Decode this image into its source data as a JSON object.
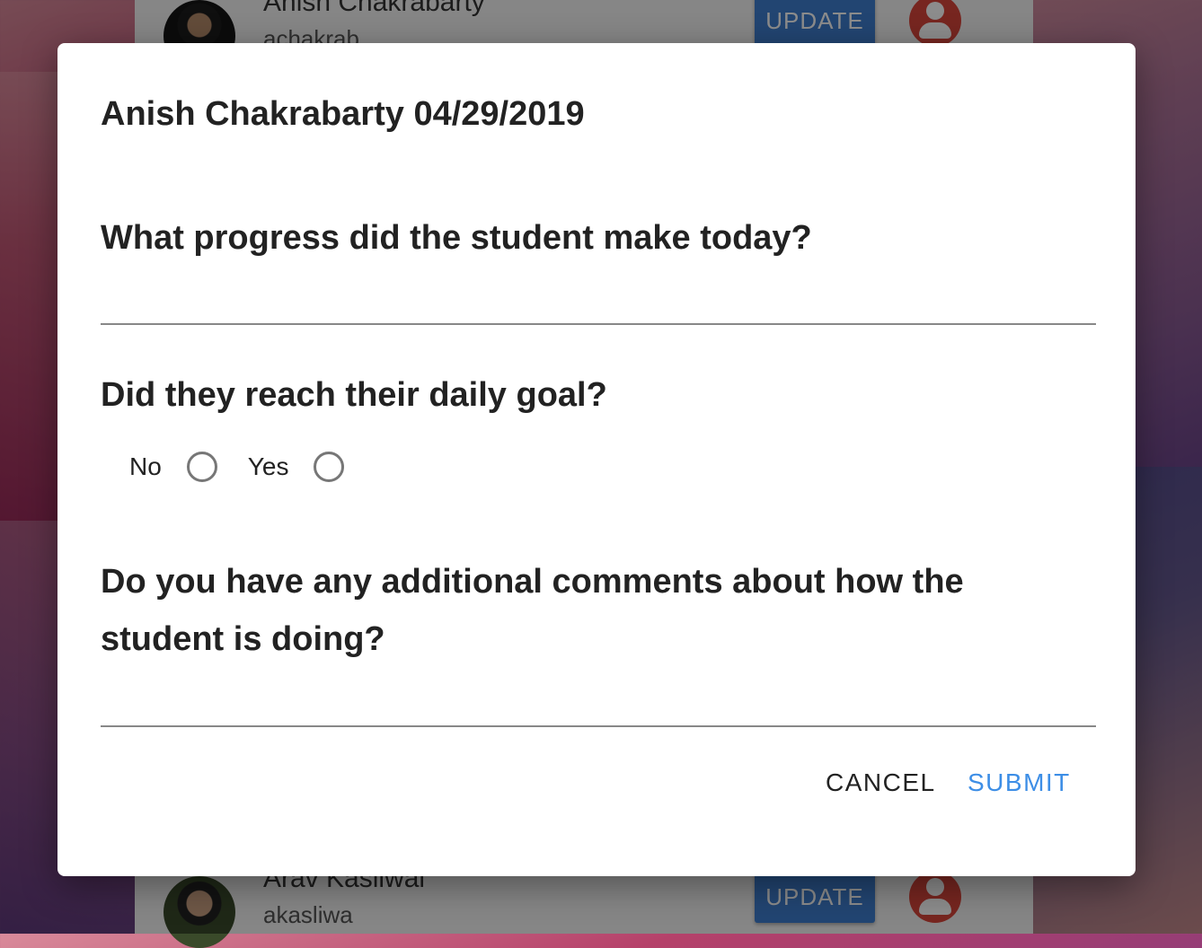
{
  "background_list": {
    "rows": [
      {
        "name": "Anish Chakrabarty",
        "username": "achakrab",
        "button": "UPDATE"
      },
      {
        "name": "Arav Kasliwal",
        "username": "akasliwa",
        "button": "UPDATE"
      }
    ]
  },
  "dialog": {
    "title": "Anish Chakrabarty 04/29/2019",
    "question_progress": "What progress did the student make today?",
    "progress_value": "",
    "question_goal": "Did they reach their daily goal?",
    "goal_options": {
      "no": "No",
      "yes": "Yes"
    },
    "question_comments": "Do you have any additional comments about how the student is doing?",
    "comments_value": "",
    "cancel_label": "CANCEL",
    "submit_label": "SUBMIT"
  },
  "colors": {
    "update_button": "#3f7fd0",
    "person_icon": "#d9453b",
    "submit_text": "#3d8ee6"
  }
}
